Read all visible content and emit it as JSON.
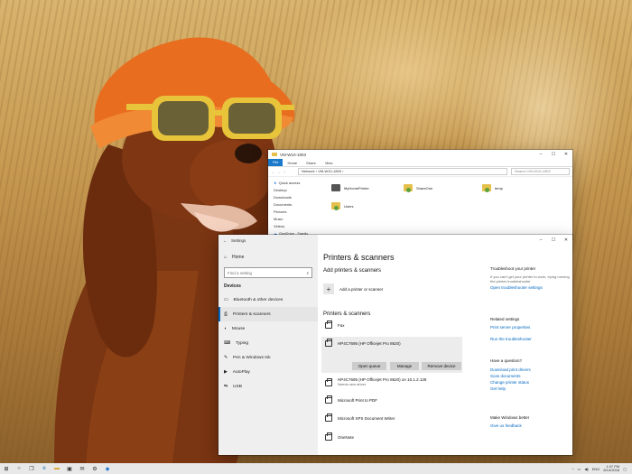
{
  "explorer": {
    "title": "VM-W10-1803",
    "ribbon": [
      "File",
      "Home",
      "Share",
      "View"
    ],
    "address": "Network  ›  VM-W10-1803  ›",
    "search_placeholder": "Search VM-W10-1803",
    "nav": [
      "Quick access",
      "Desktop",
      "Downloads",
      "Documents",
      "Pictures",
      "Music",
      "Videos",
      "OneDrive - Family"
    ],
    "items": [
      "MyHomePrinter",
      "ShareOne",
      "temp",
      "Users"
    ]
  },
  "settings": {
    "title": "Settings",
    "home": "Home",
    "find_placeholder": "Find a setting",
    "section": "Devices",
    "nav": [
      "Bluetooth & other devices",
      "Printers & scanners",
      "Mouse",
      "Typing",
      "Pen & Windows Ink",
      "AutoPlay",
      "USB"
    ],
    "page_title": "Printers & scanners",
    "add_heading": "Add printers & scanners",
    "add_label": "Add a printer or scanner",
    "list_heading": "Printers & scanners",
    "printers": [
      {
        "name": "Fax",
        "status": ""
      },
      {
        "name": "HP4C7695 (HP Officejet Pro 8620)",
        "status": ""
      },
      {
        "name": "HP4C7695 (HP Officejet Pro 8620) on 10.1.2.128",
        "status": "Needs new driver"
      },
      {
        "name": "Microsoft Print to PDF",
        "status": ""
      },
      {
        "name": "Microsoft XPS Document Writer",
        "status": ""
      },
      {
        "name": "OneNote",
        "status": ""
      }
    ],
    "buttons": {
      "open_queue": "Open queue",
      "manage": "Manage",
      "remove": "Remove device"
    },
    "right": {
      "trouble_heading": "Troubleshoot your printer",
      "trouble_text": "If you can't get your printer to work, trying running the printer troubleshooter",
      "trouble_link": "Open troubleshooter settings",
      "related_heading": "Related settings",
      "related_links": [
        "Print server properties",
        "Run the troubleshooter"
      ],
      "question_heading": "Have a question?",
      "question_links": [
        "Download print drivers",
        "Scan documents",
        "Change printer status",
        "Get help"
      ],
      "better_heading": "Make Windows better",
      "better_link": "Give us feedback"
    }
  },
  "taskbar": {
    "lang": "ENG",
    "time": "1:37 PM",
    "date": "8/14/2018"
  },
  "colors": {
    "accent": "#0067c0",
    "file_tab": "#1979ca"
  }
}
